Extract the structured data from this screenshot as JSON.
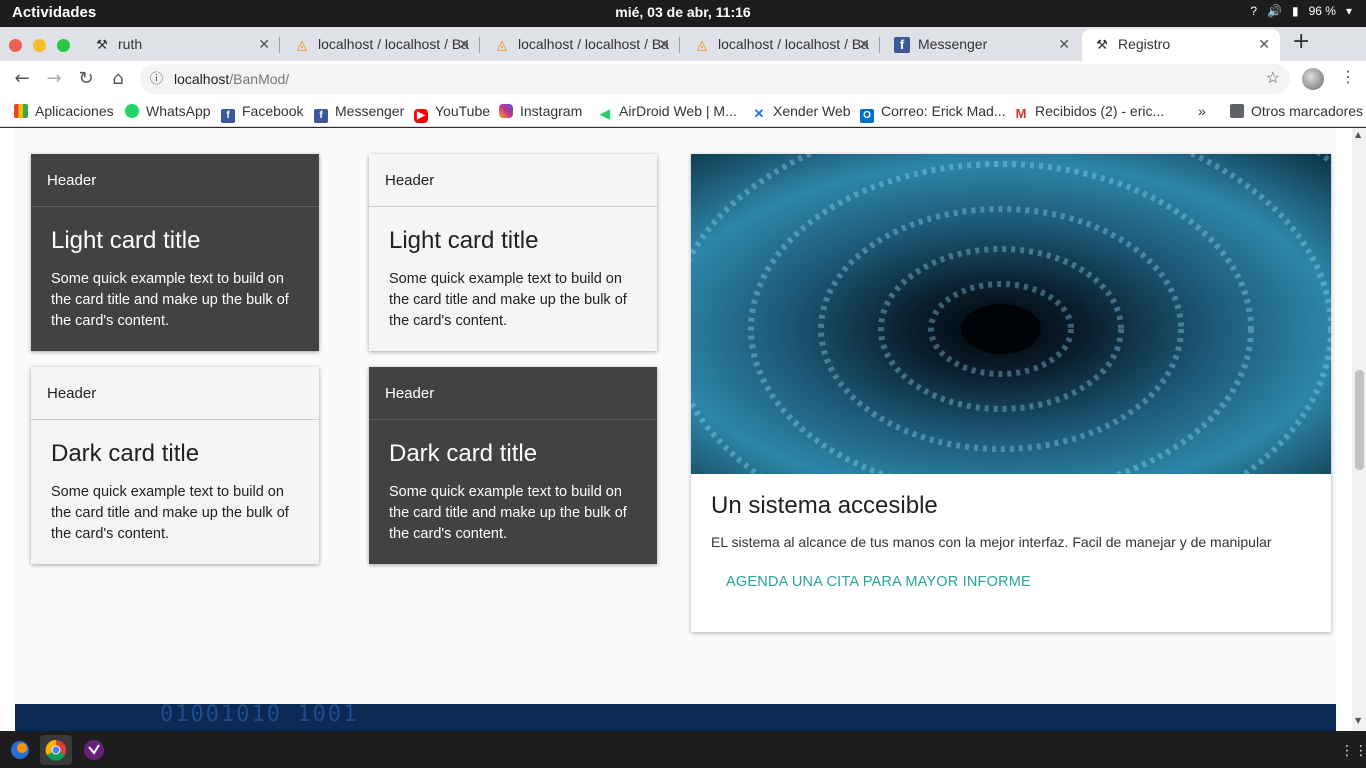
{
  "system": {
    "activities": "Actividades",
    "clock": "mié, 03 de abr, 11:16",
    "battery": "96 %"
  },
  "tabs": [
    {
      "title": "ruth",
      "icon": "tool-icon"
    },
    {
      "title": "localhost / localhost / Ba",
      "icon": "phpmyadmin-icon"
    },
    {
      "title": "localhost / localhost / Ba",
      "icon": "phpmyadmin-icon"
    },
    {
      "title": "localhost / localhost / Ba",
      "icon": "phpmyadmin-icon"
    },
    {
      "title": "Messenger",
      "icon": "facebook-icon"
    },
    {
      "title": "Registro",
      "icon": "tool-icon",
      "active": true
    }
  ],
  "address": {
    "host": "localhost",
    "path": "/BanMod/"
  },
  "bookmarks": [
    {
      "label": "Aplicaciones",
      "color": "#e0e0e0"
    },
    {
      "label": "WhatsApp",
      "color": "#25d366"
    },
    {
      "label": "Facebook",
      "color": "#3b5998"
    },
    {
      "label": "Messenger",
      "color": "#3b5998"
    },
    {
      "label": "YouTube",
      "color": "#ff0000"
    },
    {
      "label": "Instagram",
      "color": "#c13584"
    },
    {
      "label": "AirDroid Web | M...",
      "color": "#2ecc71"
    },
    {
      "label": "Xender Web",
      "color": "#1a73e8"
    },
    {
      "label": "Correo: Erick Mad...",
      "color": "#0072c6"
    },
    {
      "label": "Recibidos (2) - eric...",
      "color": "#d93025"
    }
  ],
  "other_bookmarks": "Otros marcadores",
  "cards": [
    {
      "header": "Header",
      "title": "Light card title",
      "text": "Some quick example text to build on the card title and make up the bulk of the card's content.",
      "theme": "dark"
    },
    {
      "header": "Header",
      "title": "Light card title",
      "text": "Some quick example text to build on the card title and make up the bulk of the card's content.",
      "theme": "light"
    },
    {
      "header": "Header",
      "title": "Dark card title",
      "text": "Some quick example text to build on the card title and make up the bulk of the card's content.",
      "theme": "light"
    },
    {
      "header": "Header",
      "title": "Dark card title",
      "text": "Some quick example text to build on the card title and make up the bulk of the card's content.",
      "theme": "dark"
    }
  ],
  "feature": {
    "title": "Un sistema accesible",
    "description": "EL sistema al alcance de tus manos con la mejor interfaz. Facil de manejar y de manipular",
    "link": "AGENDA UNA CITA PARA MAYOR INFORME",
    "link_color": "#26a69a"
  },
  "footer": {
    "digits": "01001010 1001"
  }
}
